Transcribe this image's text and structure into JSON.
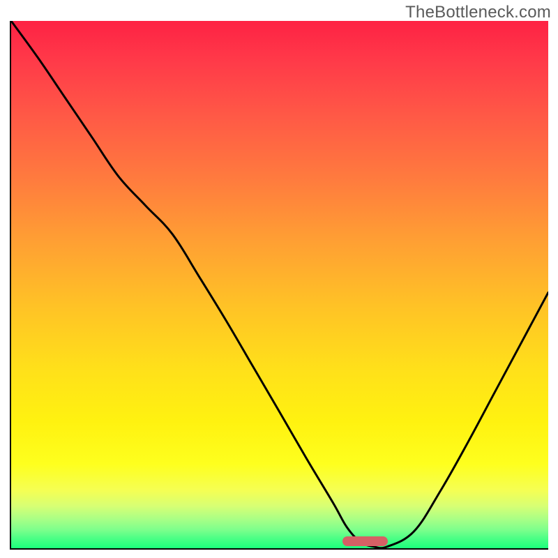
{
  "watermark": {
    "text": "TheBottleneck.com"
  },
  "chart_data": {
    "type": "line",
    "title": "",
    "xlabel": "",
    "ylabel": "",
    "xlim": [
      0,
      100
    ],
    "ylim": [
      0,
      100
    ],
    "x": [
      0,
      5,
      10,
      15,
      20,
      25,
      30,
      35,
      40,
      45,
      50,
      55,
      60,
      62.5,
      65,
      67.5,
      70,
      75,
      80,
      85,
      90,
      95,
      100
    ],
    "values": [
      100,
      93,
      85.5,
      78,
      70.5,
      65,
      59.6,
      51.5,
      43.2,
      34.5,
      25.8,
      17,
      8.5,
      4,
      1.2,
      0.3,
      0.3,
      3.2,
      11,
      20,
      29.5,
      39,
      48.5
    ],
    "optimal_range_x": [
      61.5,
      70
    ],
    "colors": {
      "gradient_top": "#fe2244",
      "gradient_bottom": "#1bff7c",
      "curve": "#000000",
      "marker": "#d56065"
    }
  }
}
